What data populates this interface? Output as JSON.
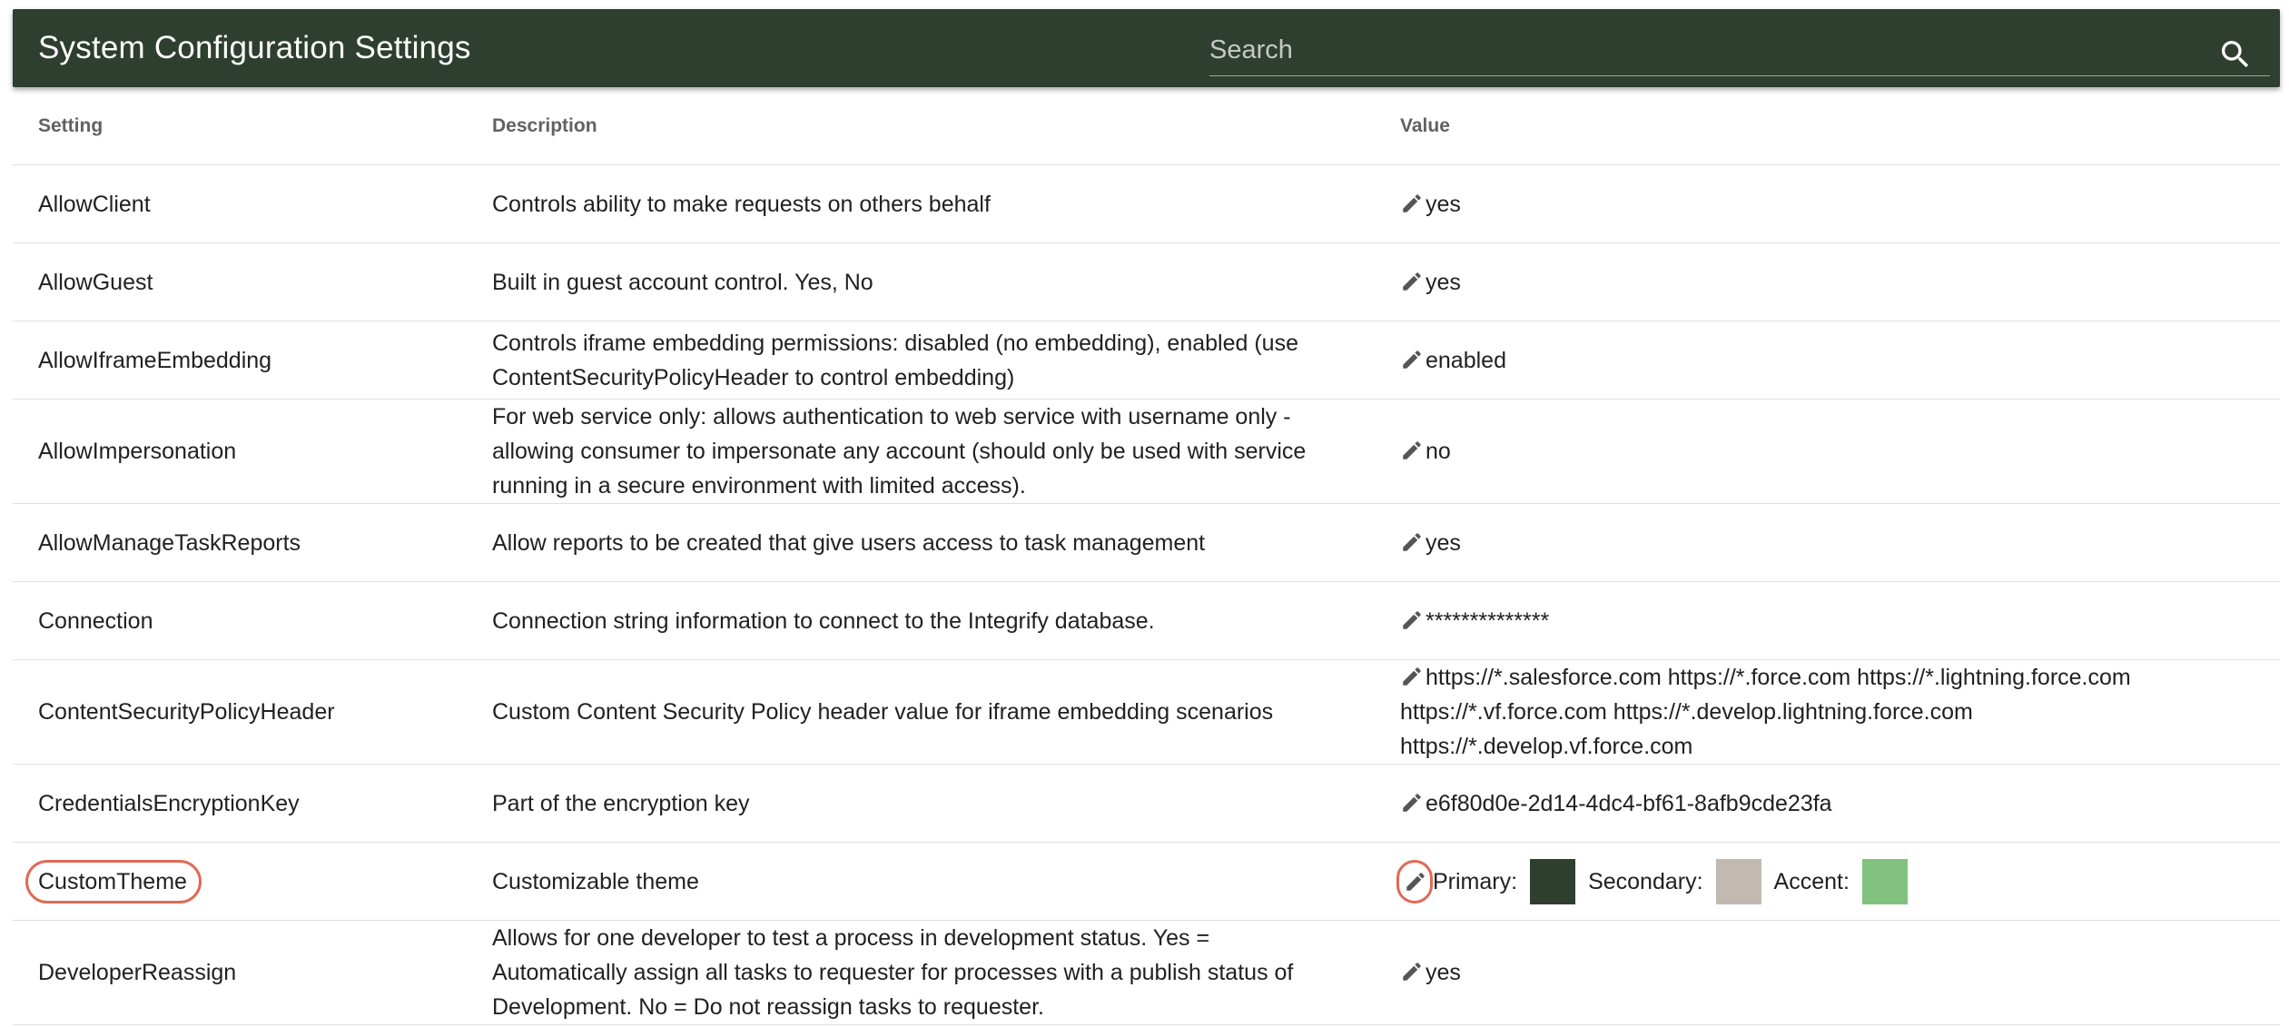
{
  "header": {
    "title": "System Configuration Settings",
    "search_placeholder": "Search"
  },
  "columns": {
    "setting": "Setting",
    "description": "Description",
    "value": "Value"
  },
  "rows": [
    {
      "setting": "AllowClient",
      "description": "Controls ability to make requests on others behalf",
      "value": "yes"
    },
    {
      "setting": "AllowGuest",
      "description": "Built in guest account control. Yes, No",
      "value": "yes"
    },
    {
      "setting": "AllowIframeEmbedding",
      "description": "Controls iframe embedding permissions: disabled (no embedding), enabled (use ContentSecurityPolicyHeader to control embedding)",
      "value": "enabled"
    },
    {
      "setting": "AllowImpersonation",
      "description": "For web service only: allows authentication to web service with username only - allowing consumer to impersonate any account (should only be used with service running in a secure environment with limited access).",
      "value": "no"
    },
    {
      "setting": "AllowManageTaskReports",
      "description": "Allow reports to be created that give users access to task management",
      "value": "yes"
    },
    {
      "setting": "Connection",
      "description": "Connection string information to connect to the Integrify database.",
      "value": "**************"
    },
    {
      "setting": "ContentSecurityPolicyHeader",
      "description": "Custom Content Security Policy header value for iframe embedding scenarios",
      "value": "https://*.salesforce.com https://*.force.com https://*.lightning.force.com https://*.vf.force.com https://*.develop.lightning.force.com https://*.develop.vf.force.com"
    },
    {
      "setting": "CredentialsEncryptionKey",
      "description": "Part of the encryption key",
      "value": "e6f80d0e-2d14-4dc4-bf61-8afb9cde23fa"
    },
    {
      "setting": "CustomTheme",
      "description": "Customizable theme",
      "theme": {
        "primary_label": "Primary:",
        "primary_color": "#2e3e2f",
        "secondary_label": "Secondary:",
        "secondary_color": "#c2b9b0",
        "accent_label": "Accent:",
        "accent_color": "#81c27f"
      }
    },
    {
      "setting": "DeveloperReassign",
      "description": "Allows for one developer to test a process in development status. Yes = Automatically assign all tasks to requester for processes with a publish status of Development. No = Do not reassign tasks to requester.",
      "value": "yes"
    }
  ],
  "icons": {
    "search": "search-icon",
    "edit": "pencil-icon"
  },
  "colors": {
    "toolbar_bg": "#2e3e2f",
    "highlight": "#e06a55"
  }
}
